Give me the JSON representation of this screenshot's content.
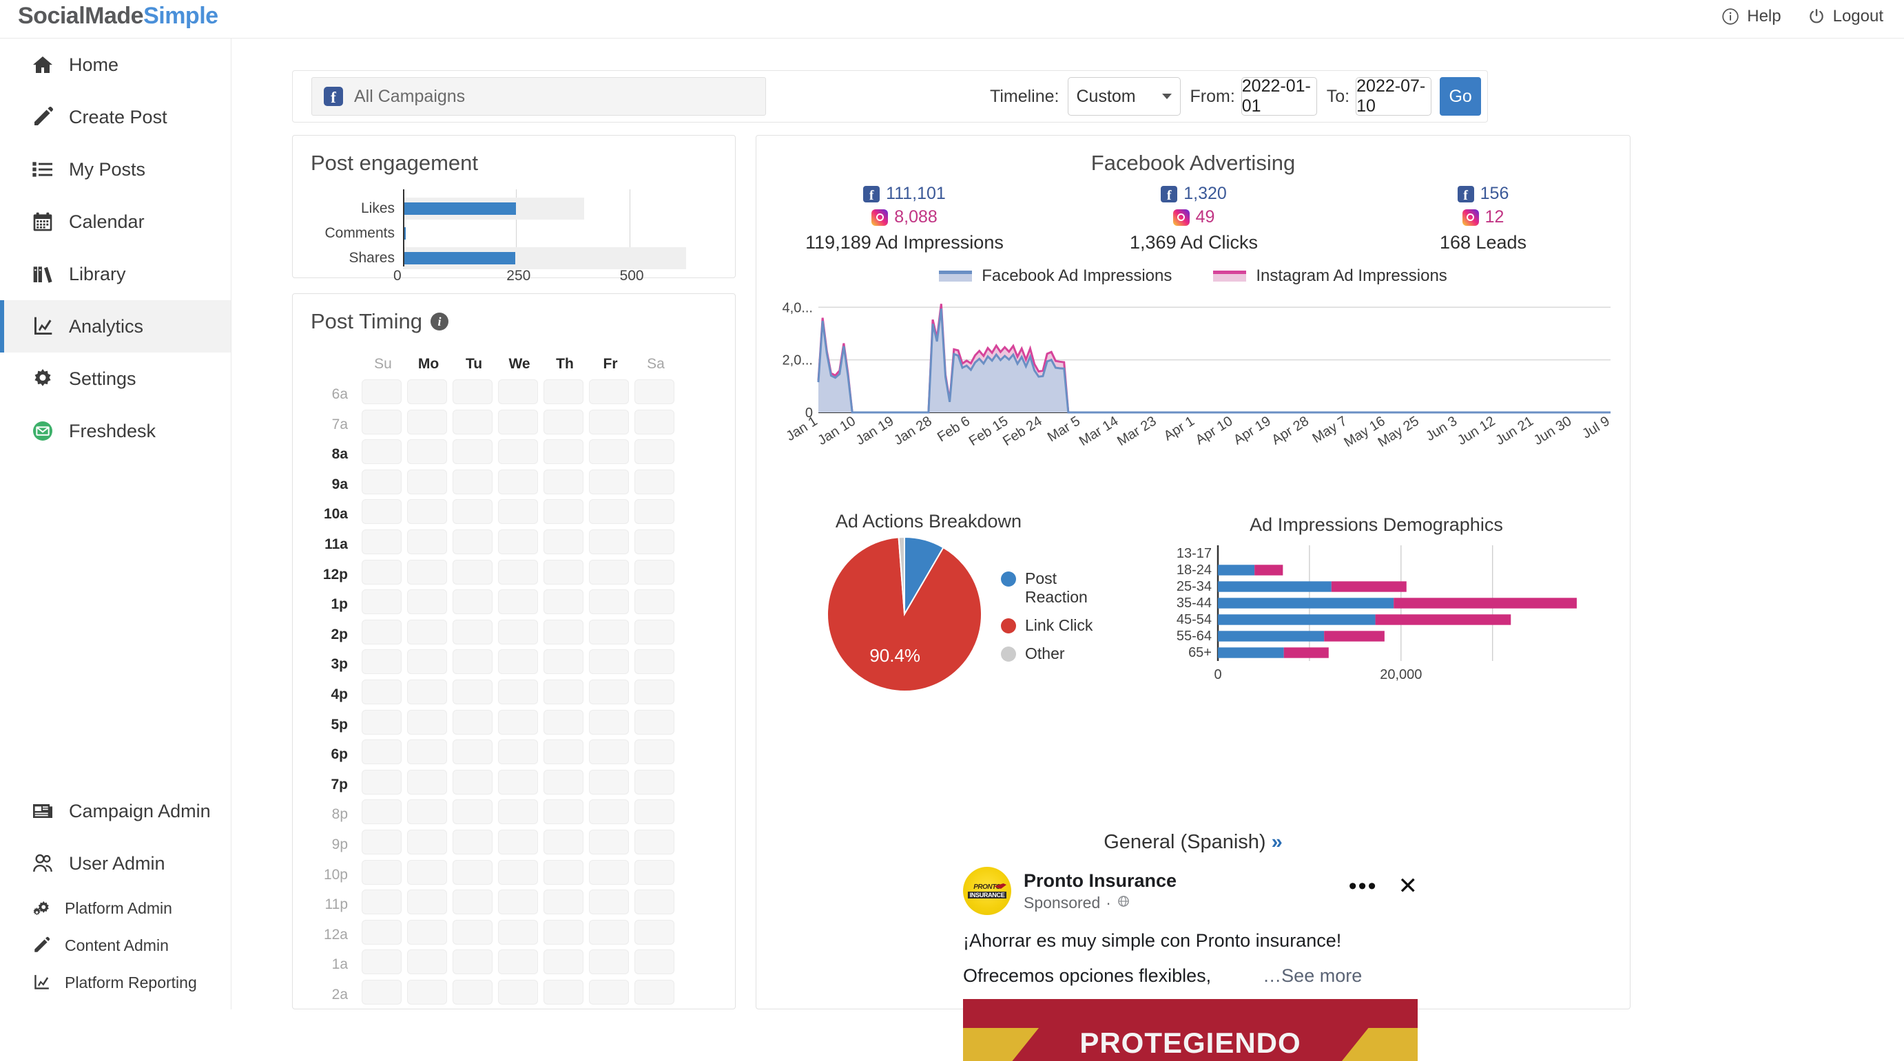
{
  "brand": {
    "part1": "SocialMade",
    "part2": "Simple",
    "accent": "#4a90d9"
  },
  "header": {
    "help_label": "Help",
    "logout_label": "Logout",
    "help_icon": "info-circle-icon",
    "logout_icon": "power-icon"
  },
  "sidebar": {
    "items": [
      {
        "label": "Home",
        "icon": "home-icon",
        "active": false
      },
      {
        "label": "Create Post",
        "icon": "pencil-icon",
        "active": false
      },
      {
        "label": "My Posts",
        "icon": "list-icon",
        "active": false
      },
      {
        "label": "Calendar",
        "icon": "calendar-icon",
        "active": false
      },
      {
        "label": "Library",
        "icon": "books-icon",
        "active": false
      },
      {
        "label": "Analytics",
        "icon": "chart-line-icon",
        "active": true
      },
      {
        "label": "Settings",
        "icon": "gear-icon",
        "active": false
      },
      {
        "label": "Freshdesk",
        "icon": "envelope-circle-icon",
        "active": false
      }
    ],
    "bottom_items": [
      {
        "label": "Campaign Admin",
        "icon": "newspaper-icon",
        "size": "large"
      },
      {
        "label": "User Admin",
        "icon": "users-icon",
        "size": "large"
      },
      {
        "label": "Platform Admin",
        "icon": "cogs-icon",
        "size": "small"
      },
      {
        "label": "Content Admin",
        "icon": "pencil-icon",
        "size": "small"
      },
      {
        "label": "Platform Reporting",
        "icon": "chart-line-icon",
        "size": "small"
      }
    ]
  },
  "filterbar": {
    "campaign_value": "All Campaigns",
    "campaign_icon": "facebook-icon",
    "timeline_label": "Timeline:",
    "timeline_value": "Custom",
    "timeline_options": [
      "Custom"
    ],
    "from_label": "From:",
    "from_value": "2022-01-01",
    "to_label": "To:",
    "to_value": "2022-07-10",
    "go_label": "Go"
  },
  "engagement": {
    "title": "Post engagement"
  },
  "post_timing": {
    "title": "Post Timing",
    "info_icon": "info-icon",
    "info_glyph": "i",
    "days": [
      {
        "label": "Su",
        "muted": true
      },
      {
        "label": "Mo",
        "muted": false
      },
      {
        "label": "Tu",
        "muted": false
      },
      {
        "label": "We",
        "muted": false
      },
      {
        "label": "Th",
        "muted": false
      },
      {
        "label": "Fr",
        "muted": false
      },
      {
        "label": "Sa",
        "muted": true
      }
    ],
    "hours": [
      {
        "label": "6a",
        "muted": true
      },
      {
        "label": "7a",
        "muted": true
      },
      {
        "label": "8a",
        "muted": false
      },
      {
        "label": "9a",
        "muted": false
      },
      {
        "label": "10a",
        "muted": false
      },
      {
        "label": "11a",
        "muted": false
      },
      {
        "label": "12p",
        "muted": false
      },
      {
        "label": "1p",
        "muted": false
      },
      {
        "label": "2p",
        "muted": false
      },
      {
        "label": "3p",
        "muted": false
      },
      {
        "label": "4p",
        "muted": false
      },
      {
        "label": "5p",
        "muted": false
      },
      {
        "label": "6p",
        "muted": false
      },
      {
        "label": "7p",
        "muted": false
      },
      {
        "label": "8p",
        "muted": true
      },
      {
        "label": "9p",
        "muted": true
      },
      {
        "label": "10p",
        "muted": true
      },
      {
        "label": "11p",
        "muted": true
      },
      {
        "label": "12a",
        "muted": true
      },
      {
        "label": "1a",
        "muted": true
      },
      {
        "label": "2a",
        "muted": true
      }
    ]
  },
  "facebook_advertising": {
    "title": "Facebook Advertising",
    "stats": [
      {
        "fb_value": "111,101",
        "ig_value": "8,088",
        "total": "119,189 Ad Impressions"
      },
      {
        "fb_value": "1,320",
        "ig_value": "49",
        "total": "1,369 Ad Clicks"
      },
      {
        "fb_value": "156",
        "ig_value": "12",
        "total": "168 Leads"
      }
    ],
    "general_label": "General (Spanish)",
    "general_chevron": "»"
  },
  "ad_preview": {
    "page_name": "Pronto Insurance",
    "sponsored": "Sponsored",
    "sponsored_icon": "globe-icon",
    "sponsored_dot": "·",
    "menu_icon": "ellipsis-icon",
    "close_icon": "close-icon",
    "body_line1": "¡Ahorrar es muy simple con Pronto insurance!",
    "body_line2": "Ofrecemos opciones flexibles,",
    "see_more": "…See more",
    "logo_text1": "PRONTO",
    "logo_text2": "INSURANCE",
    "image_word": "PROTEGIENDO"
  },
  "chart_data": [
    {
      "type": "bar",
      "name": "post-engagement",
      "orientation": "horizontal",
      "title": "Post engagement",
      "categories": [
        "Likes",
        "Comments",
        "Shares"
      ],
      "values": [
        249,
        6,
        248
      ],
      "background_values": [
        400,
        0,
        625
      ],
      "xlabel": "",
      "ylabel": "",
      "xticks": [
        "0",
        "250",
        "500"
      ],
      "xtick_values": [
        0,
        250,
        500
      ],
      "xlim": [
        0,
        700
      ],
      "bar_color": "#3b82c4",
      "track_color": "#efefef",
      "grid": true
    },
    {
      "type": "area",
      "name": "ad-impressions-timeline",
      "title": "",
      "legend": [
        "Facebook Ad Impressions",
        "Instagram Ad Impressions"
      ],
      "legend_position": "top",
      "legend_colors": [
        "#6a8fc4",
        "#d6449a"
      ],
      "fill_colors": [
        "#c3cde4",
        "#edc7de"
      ],
      "ylabel": "",
      "xlabel": "",
      "yticks": [
        "0",
        "2,0...",
        "4,0..."
      ],
      "ytick_values": [
        0,
        2000,
        4000
      ],
      "ylim": [
        0,
        4400
      ],
      "grid": true,
      "xticks": [
        "Jan 1",
        "Jan 10",
        "Jan 19",
        "Jan 28",
        "Feb 6",
        "Feb 15",
        "Feb 24",
        "Mar 5",
        "Mar 14",
        "Mar 23",
        "Apr 1",
        "Apr 10",
        "Apr 19",
        "Apr 28",
        "May 7",
        "May 16",
        "May 25",
        "Jun 3",
        "Jun 12",
        "Jun 21",
        "Jun 30",
        "Jul 9"
      ],
      "series": [
        {
          "name": "Facebook Ad Impressions",
          "values": [
            1150,
            3480,
            2250,
            1400,
            1320,
            1460,
            2520,
            1380,
            0,
            0,
            0,
            0,
            0,
            0,
            0,
            0,
            0,
            0,
            0,
            0,
            0,
            0,
            0,
            0,
            0,
            0,
            0,
            3370,
            2700,
            3950,
            1350,
            400,
            2220,
            2160,
            1700,
            1780,
            1620,
            1900,
            2040,
            1860,
            2130,
            1970,
            2200,
            1990,
            2150,
            2010,
            2200,
            1850,
            2110,
            1750,
            2120,
            1600,
            1360,
            1380,
            1940,
            2000,
            1700,
            1680,
            1670,
            0,
            0,
            0,
            0,
            0,
            0,
            0,
            0,
            0,
            0,
            0,
            0,
            0,
            0,
            0,
            0,
            0,
            0,
            0,
            0,
            0,
            0,
            0,
            0,
            0,
            0,
            0,
            0,
            0,
            0,
            0,
            0,
            0,
            0,
            0,
            0,
            0,
            0,
            0,
            0,
            0,
            0,
            0,
            0,
            0,
            0,
            0,
            0,
            0,
            0,
            0,
            0,
            0,
            0,
            0,
            0,
            0,
            0,
            0,
            0,
            0,
            0,
            0,
            0,
            0,
            0,
            0,
            0,
            0,
            0,
            0,
            0,
            0,
            0,
            0,
            0,
            0,
            0,
            0,
            0,
            0,
            0,
            0,
            0,
            0,
            0,
            0,
            0,
            0,
            0,
            0,
            0,
            0,
            0,
            0,
            0,
            0,
            0,
            0,
            0,
            0,
            0,
            0,
            0,
            0,
            0,
            0,
            0,
            0,
            0,
            0,
            0,
            0,
            0,
            0,
            0,
            0,
            0,
            0,
            0,
            0,
            0,
            0,
            0,
            0,
            0,
            0,
            0,
            0
          ]
        },
        {
          "name": "Instagram Ad Impressions",
          "values": [
            60,
            120,
            80,
            90,
            85,
            130,
            110,
            95,
            0,
            0,
            0,
            0,
            0,
            0,
            0,
            0,
            0,
            0,
            0,
            0,
            0,
            0,
            0,
            0,
            0,
            0,
            0,
            160,
            120,
            180,
            95,
            40,
            180,
            200,
            160,
            190,
            250,
            270,
            300,
            290,
            320,
            300,
            340,
            310,
            330,
            300,
            330,
            270,
            320,
            260,
            310,
            240,
            200,
            210,
            290,
            300,
            260,
            250,
            240,
            0,
            0,
            0,
            0,
            0,
            0,
            0,
            0,
            0,
            0,
            0,
            0,
            0,
            0,
            0,
            0,
            0,
            0,
            0,
            0,
            0,
            0,
            0,
            0,
            0,
            0,
            0,
            0,
            0,
            0,
            0,
            0,
            0,
            0,
            0,
            0,
            0,
            0,
            0,
            0,
            0,
            0,
            0,
            0,
            0,
            0,
            0,
            0,
            0,
            0,
            0,
            0,
            0,
            0,
            0,
            0,
            0,
            0,
            0,
            0,
            0,
            0,
            0,
            0,
            0,
            0,
            0,
            0,
            0,
            0,
            0,
            0,
            0,
            0,
            0,
            0,
            0,
            0,
            0,
            0,
            0,
            0,
            0,
            0,
            0,
            0,
            0,
            0,
            0,
            0,
            0,
            0,
            0,
            0,
            0,
            0,
            0,
            0,
            0,
            0,
            0,
            0,
            0,
            0,
            0,
            0,
            0,
            0,
            0,
            0,
            0,
            0,
            0,
            0,
            0,
            0,
            0,
            0,
            0,
            0,
            0,
            0,
            0,
            0,
            0,
            0,
            0,
            0,
            0
          ]
        }
      ]
    },
    {
      "type": "pie",
      "name": "ad-actions-breakdown",
      "title": "Ad Actions Breakdown",
      "labels": [
        "Post Reaction",
        "Link Click",
        "Other"
      ],
      "values": [
        8.4,
        90.4,
        1.2
      ],
      "colors": [
        "#3b82c4",
        "#d33b33",
        "#cccccc"
      ],
      "data_labels": [
        "",
        "90.4%",
        ""
      ],
      "legend_position": "right"
    },
    {
      "type": "bar",
      "name": "ad-impressions-demographics",
      "title": "Ad Impressions Demographics",
      "orientation": "horizontal",
      "stacked": true,
      "categories": [
        "13-17",
        "18-24",
        "25-34",
        "35-44",
        "45-54",
        "55-64",
        "65+"
      ],
      "series": [
        {
          "name": "male",
          "values": [
            0,
            4000,
            12400,
            19200,
            17200,
            11600,
            7200
          ],
          "color": "#3b82c4"
        },
        {
          "name": "female",
          "values": [
            0,
            3100,
            8200,
            20000,
            14800,
            6600,
            4900
          ],
          "color": "#ce2d7d"
        }
      ],
      "xticks": [
        "0",
        "20,000"
      ],
      "xtick_values": [
        0,
        20000
      ],
      "gridline_values": [
        0,
        10000,
        20000,
        30000
      ],
      "xlim": [
        0,
        38000
      ],
      "grid": true
    }
  ]
}
